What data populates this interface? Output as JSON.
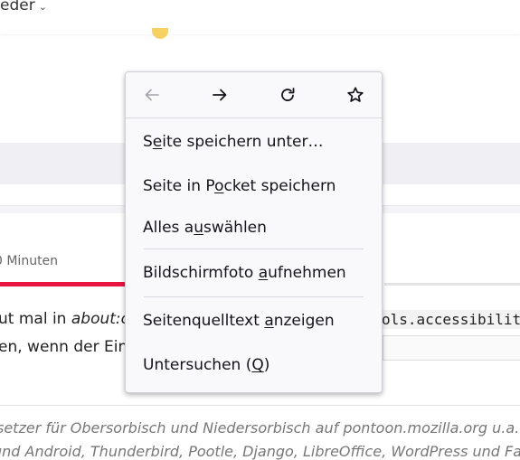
{
  "background": {
    "nav_text": "eder",
    "meta_text": "0 Minuten",
    "para1_a": "ut mal in ",
    "para1_b": "about:c",
    "para2": "en, wenn der Eint",
    "code_text": "ols.accessibilit",
    "footer_line1": "setzer für Obersorbisch und Niedersorbisch auf pontoon.mozilla.org u.a. ",
    "footer_line2": "und Android, Thunderbird, Pootle, Django, LibreOffice, WordPress und Face"
  },
  "context_menu": {
    "nav": {
      "back_icon": "arrow-left-icon",
      "forward_icon": "arrow-right-icon",
      "reload_icon": "reload-icon",
      "bookmark_icon": "star-icon"
    },
    "items": [
      {
        "pre": "S",
        "key": "e",
        "post": "ite speichern unter…"
      },
      {
        "pre": "Seite in P",
        "key": "o",
        "post": "cket speichern"
      },
      {
        "pre": "Alles a",
        "key": "u",
        "post": "swählen"
      },
      {
        "pre": "Bildschirmfoto ",
        "key": "a",
        "post": "ufnehmen"
      },
      {
        "pre": "Seitenquelltext ",
        "key": "a",
        "post": "nzeigen"
      },
      {
        "pre": "Untersuchen (",
        "key": "Q",
        "post": ")"
      }
    ]
  }
}
